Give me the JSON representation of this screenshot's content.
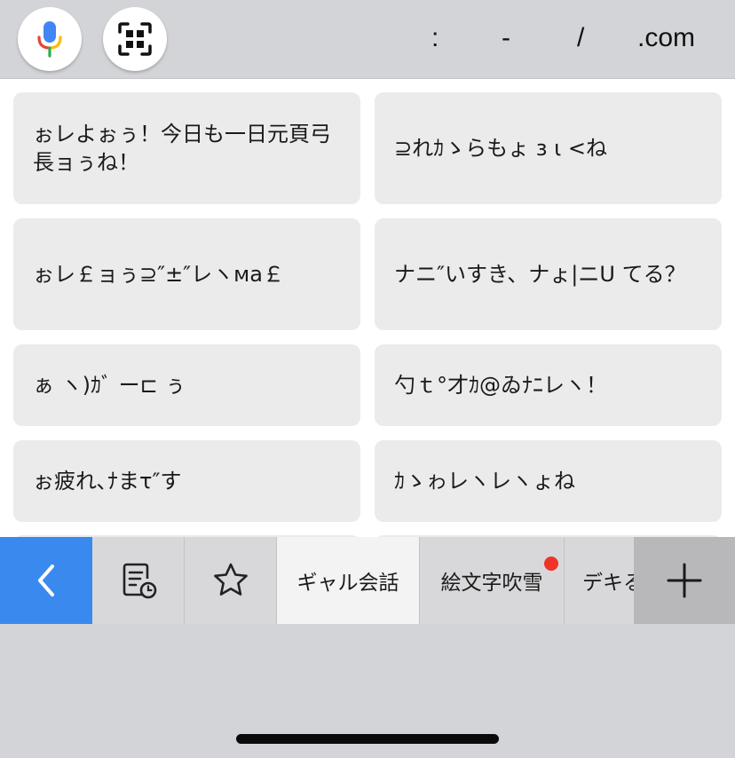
{
  "toolbar": {
    "symbols": [
      ":",
      "-",
      "/",
      ".com"
    ],
    "icons": [
      "microphone-icon",
      "qr-scan-icon"
    ]
  },
  "phrases": [
    "ぉレよぉぅ！今日も一日元頁弓長ョぅね！",
    "⊇れｶゝらもょ з ι <ね",
    "ぉレ￡ョぅ⊇″±″レヽмa￡",
    "ナニ″いすき、ナょ|ニU てる？",
    "ぁ ヽ)ｶﾞ ー⊏ ぅ",
    "勺ｔ°才ｶ@ゐﾅﾆレヽ！",
    "ぉ疲れ､ﾅまτ″す",
    "ｶゝゎレヽレヽょね"
  ],
  "tabs": {
    "items": [
      "ギャル会話",
      "絵文字吹雪",
      "デキる"
    ],
    "icons": [
      "back-chevron-icon",
      "history-icon",
      "star-icon",
      "plus-icon"
    ],
    "active_index": 0,
    "notification_badge_on": "絵文字吹雪"
  },
  "colors": {
    "accent": "#3a89ee",
    "badge": "#ee3427",
    "card": "#ebebeb",
    "keyboard_bg": "#d3d4d8"
  }
}
